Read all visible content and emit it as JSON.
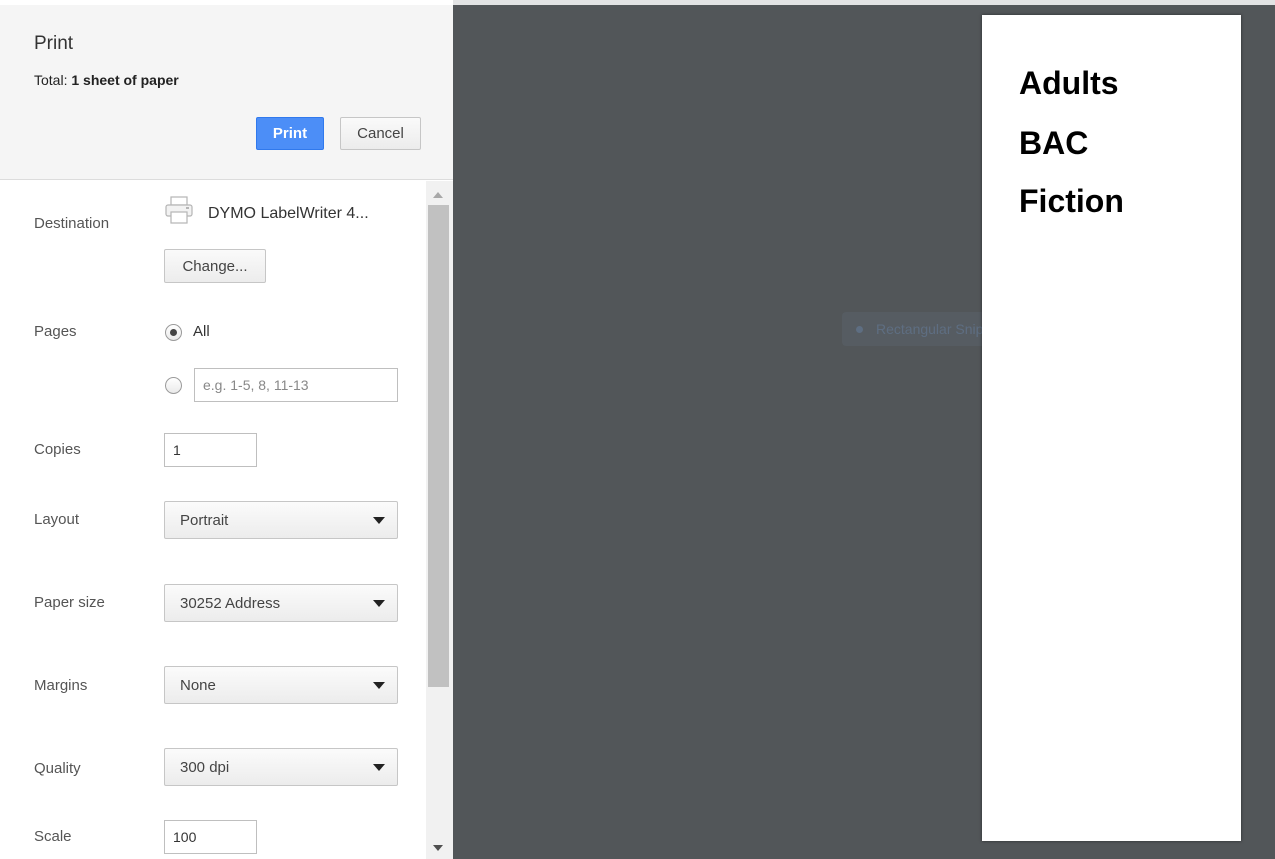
{
  "header": {
    "title": "Print",
    "total_label": "Total:",
    "total_value": "1 sheet of paper",
    "print_button": "Print",
    "cancel_button": "Cancel"
  },
  "settings": {
    "destination": {
      "label": "Destination",
      "printer_name": "DYMO LabelWriter 4...",
      "change_button": "Change...",
      "icon": "printer-icon"
    },
    "pages": {
      "label": "Pages",
      "all_label": "All",
      "selected": "All",
      "custom_placeholder": "e.g. 1-5, 8, 11-13"
    },
    "copies": {
      "label": "Copies",
      "value": "1"
    },
    "layout": {
      "label": "Layout",
      "value": "Portrait"
    },
    "paper_size": {
      "label": "Paper size",
      "value": "30252 Address"
    },
    "margins": {
      "label": "Margins",
      "value": "None"
    },
    "quality": {
      "label": "Quality",
      "value": "300 dpi"
    },
    "scale": {
      "label": "Scale",
      "value": "100"
    }
  },
  "preview": {
    "page_lines": [
      "Adults",
      "BAC",
      "Fiction"
    ],
    "overlay_text": "Rectangular Snip"
  },
  "colors": {
    "primary_button": "#4c8ef7",
    "preview_background": "#525659"
  }
}
